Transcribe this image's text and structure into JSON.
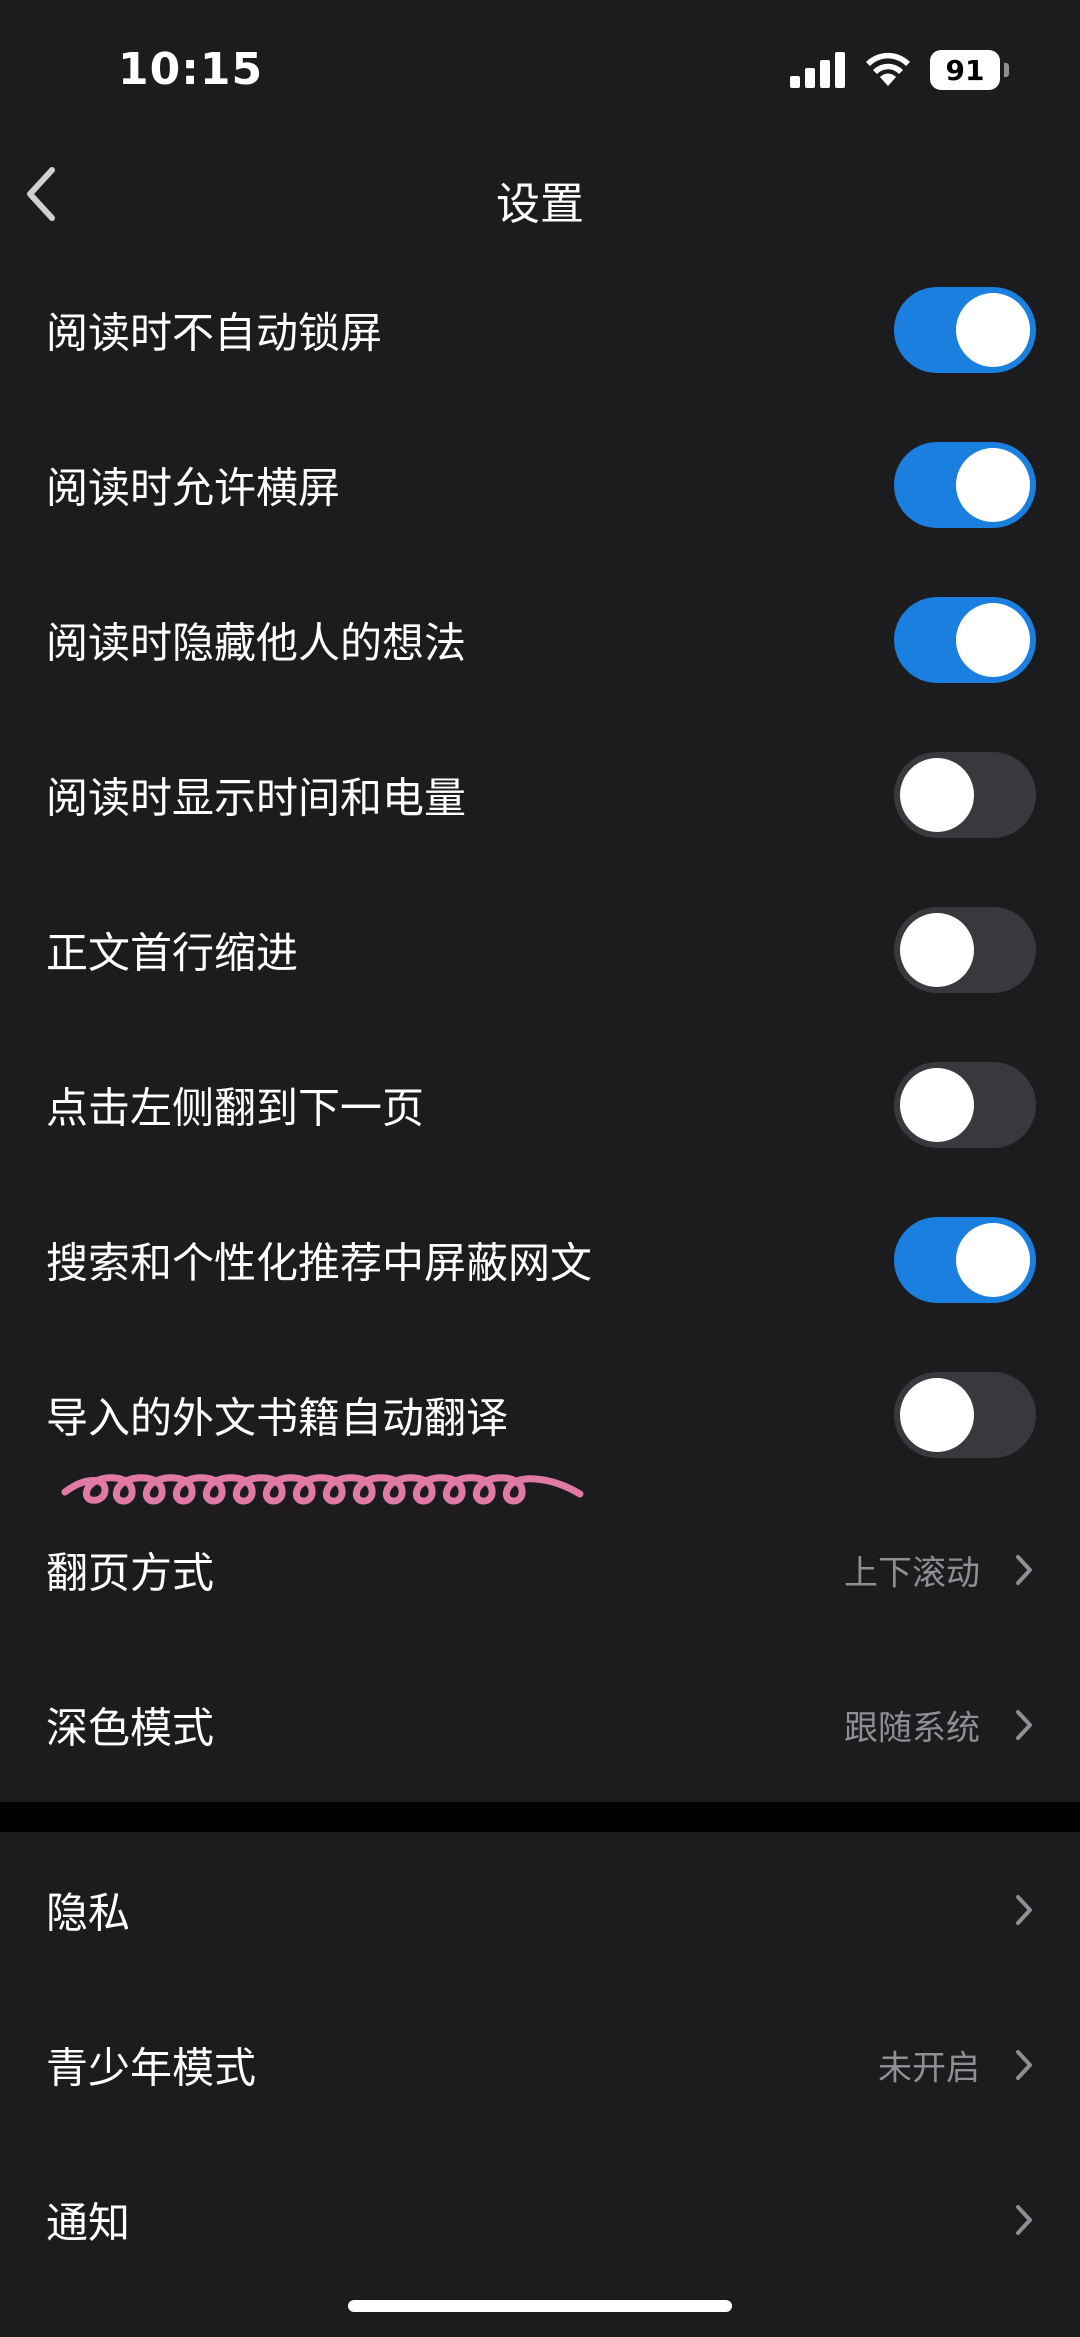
{
  "status_bar": {
    "time": "10:15",
    "battery": "91"
  },
  "header": {
    "title": "设置"
  },
  "toggle_rows": [
    {
      "label": "阅读时不自动锁屏",
      "on": true
    },
    {
      "label": "阅读时允许横屏",
      "on": true
    },
    {
      "label": "阅读时隐藏他人的想法",
      "on": true
    },
    {
      "label": "阅读时显示时间和电量",
      "on": false
    },
    {
      "label": "正文首行缩进",
      "on": false
    },
    {
      "label": "点击左侧翻到下一页",
      "on": false
    },
    {
      "label": "搜索和个性化推荐中屏蔽网文",
      "on": true
    },
    {
      "label": "导入的外文书籍自动翻译",
      "on": false
    }
  ],
  "nav_rows": [
    {
      "label": "翻页方式",
      "value": "上下滚动"
    },
    {
      "label": "深色模式",
      "value": "跟随系统"
    }
  ],
  "nav_rows2": [
    {
      "label": "隐私",
      "value": ""
    },
    {
      "label": "青少年模式",
      "value": "未开启"
    },
    {
      "label": "通知",
      "value": ""
    }
  ],
  "colors": {
    "background": "#1c1c1e",
    "toggle_on": "#1a7fde",
    "toggle_off": "#39393d",
    "value_text": "#8e8e93",
    "squiggle": "#e07aa4"
  }
}
